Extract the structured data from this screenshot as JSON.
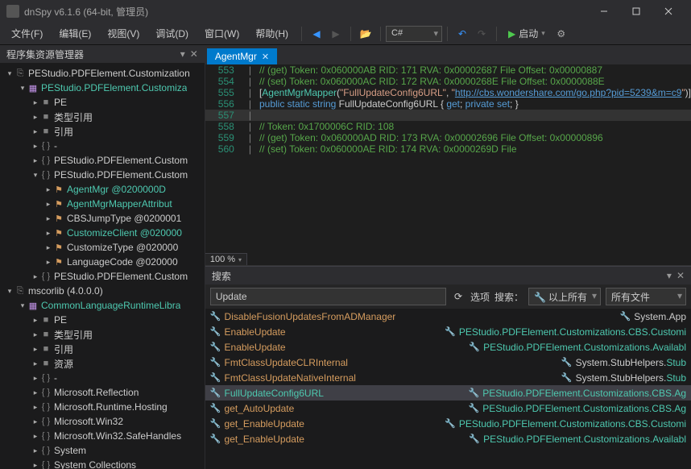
{
  "titlebar": {
    "title": "dnSpy v6.1.6 (64-bit, 管理员)"
  },
  "menu": {
    "file": "文件(F)",
    "edit": "编辑(E)",
    "view": "视图(V)",
    "debug": "调试(D)",
    "window": "窗口(W)",
    "help": "帮助(H)",
    "lang": "C#",
    "run": "启动"
  },
  "sidebar": {
    "title": "程序集资源管理器",
    "tree": [
      {
        "d": 0,
        "exp": "▾",
        "icon": "⎘",
        "iconClass": "gray",
        "label": "PEStudio.PDFElement.Customization",
        "cls": ""
      },
      {
        "d": 1,
        "exp": "▾",
        "icon": "▦",
        "iconClass": "purple",
        "label": "PEStudio.PDFElement.Customiza",
        "cls": "teal"
      },
      {
        "d": 2,
        "exp": "▸",
        "icon": "■",
        "iconClass": "gray",
        "label": "PE",
        "cls": ""
      },
      {
        "d": 2,
        "exp": "▸",
        "icon": "■",
        "iconClass": "gray",
        "label": "类型引用",
        "cls": ""
      },
      {
        "d": 2,
        "exp": "▸",
        "icon": "■",
        "iconClass": "gray",
        "label": "引用",
        "cls": ""
      },
      {
        "d": 2,
        "exp": "▸",
        "icon": "{ }",
        "iconClass": "gray",
        "label": "-",
        "cls": ""
      },
      {
        "d": 2,
        "exp": "▸",
        "icon": "{ }",
        "iconClass": "gray",
        "label": "PEStudio.PDFElement.Custom",
        "cls": ""
      },
      {
        "d": 2,
        "exp": "▾",
        "icon": "{ }",
        "iconClass": "gray",
        "label": "PEStudio.PDFElement.Custom",
        "cls": ""
      },
      {
        "d": 3,
        "exp": "▸",
        "icon": "⚑",
        "iconClass": "orange",
        "label": "AgentMgr @0200000D",
        "cls": "teal",
        "suffixGray": true
      },
      {
        "d": 3,
        "exp": "▸",
        "icon": "⚑",
        "iconClass": "orange",
        "label": "AgentMgrMapperAttribut",
        "cls": "teal"
      },
      {
        "d": 3,
        "exp": "▸",
        "icon": "⚑",
        "iconClass": "orange",
        "label": "CBSJumpType @0200001",
        "cls": ""
      },
      {
        "d": 3,
        "exp": "▸",
        "icon": "⚑",
        "iconClass": "orange",
        "label": "CustomizeClient @020000",
        "cls": "teal"
      },
      {
        "d": 3,
        "exp": "▸",
        "icon": "⚑",
        "iconClass": "orange",
        "label": "CustomizeType @020000",
        "cls": ""
      },
      {
        "d": 3,
        "exp": "▸",
        "icon": "⚑",
        "iconClass": "orange",
        "label": "LanguageCode @020000",
        "cls": ""
      },
      {
        "d": 2,
        "exp": "▸",
        "icon": "{ }",
        "iconClass": "gray",
        "label": "PEStudio.PDFElement.Custom",
        "cls": ""
      },
      {
        "d": 0,
        "exp": "▾",
        "icon": "⎘",
        "iconClass": "gray",
        "label": "mscorlib (4.0.0.0)",
        "cls": ""
      },
      {
        "d": 1,
        "exp": "▾",
        "icon": "▦",
        "iconClass": "purple",
        "label": "CommonLanguageRuntimeLibra",
        "cls": "teal"
      },
      {
        "d": 2,
        "exp": "▸",
        "icon": "■",
        "iconClass": "gray",
        "label": "PE",
        "cls": ""
      },
      {
        "d": 2,
        "exp": "▸",
        "icon": "■",
        "iconClass": "gray",
        "label": "类型引用",
        "cls": ""
      },
      {
        "d": 2,
        "exp": "▸",
        "icon": "■",
        "iconClass": "gray",
        "label": "引用",
        "cls": ""
      },
      {
        "d": 2,
        "exp": "▸",
        "icon": "■",
        "iconClass": "gray",
        "label": "资源",
        "cls": ""
      },
      {
        "d": 2,
        "exp": "▸",
        "icon": "{ }",
        "iconClass": "gray",
        "label": "-",
        "cls": ""
      },
      {
        "d": 2,
        "exp": "▸",
        "icon": "{ }",
        "iconClass": "gray",
        "label": "Microsoft.Reflection",
        "cls": ""
      },
      {
        "d": 2,
        "exp": "▸",
        "icon": "{ }",
        "iconClass": "gray",
        "label": "Microsoft.Runtime.Hosting",
        "cls": ""
      },
      {
        "d": 2,
        "exp": "▸",
        "icon": "{ }",
        "iconClass": "gray",
        "label": "Microsoft.Win32",
        "cls": ""
      },
      {
        "d": 2,
        "exp": "▸",
        "icon": "{ }",
        "iconClass": "gray",
        "label": "Microsoft.Win32.SafeHandles",
        "cls": ""
      },
      {
        "d": 2,
        "exp": "▸",
        "icon": "{ }",
        "iconClass": "gray",
        "label": "System",
        "cls": ""
      },
      {
        "d": 2,
        "exp": "▸",
        "icon": "{ }",
        "iconClass": "gray",
        "label": "System Collections",
        "cls": ""
      }
    ]
  },
  "tab": {
    "label": "AgentMgr"
  },
  "code": {
    "zoom": "100 %",
    "lines": [
      {
        "n": 553,
        "html": "<span class='c-cmt'>// (get) Token: 0x060000AB RID: 171 RVA: 0x00002687 File Offset: 0x00000887</span>"
      },
      {
        "n": 554,
        "html": "<span class='c-cmt'>// (set) Token: 0x060000AC RID: 172 RVA: 0x0000268E File Offset: 0x0000088E</span>"
      },
      {
        "n": 555,
        "html": "[<span class='c-type'>AgentMgrMapper</span>(<span class='c-str'>\"FullUpdateConfig6URL\"</span>, <span class='c-str'>\"</span><span class='c-link'>http://cbs.wondershare.com/go.php?pid=5239&m=c9</span><span class='c-str'>\"</span>)]"
      },
      {
        "n": 556,
        "html": "<span class='c-kw'>public static string</span> FullUpdateConfig6URL { <span class='c-kw'>get</span>; <span class='c-kw'>private set</span>; }"
      },
      {
        "n": 557,
        "html": "",
        "hl": true
      },
      {
        "n": 558,
        "html": "<span class='c-cmt'>// Token: 0x1700006C RID: 108</span>"
      },
      {
        "n": 559,
        "html": "<span class='c-cmt'>// (get) Token: 0x060000AD RID: 173 RVA: 0x00002696 File Offset: 0x00000896</span>"
      },
      {
        "n": 560,
        "html": "<span class='c-cmt'>// (set) Token: 0x060000AE RID: 174 RVA: 0x0000269D File</span>"
      }
    ]
  },
  "search": {
    "title": "搜索",
    "query": "Update",
    "optionLabel": "选项",
    "scopeLabel": "搜索：",
    "scope": "以上所有",
    "fileScope": "所有文件",
    "results": [
      {
        "name": "DisableFusionUpdatesFromADManager",
        "loc": "System.App",
        "locClass": "",
        "sel": false
      },
      {
        "name": "EnableUpdate",
        "loc": "PEStudio.PDFElement.Customizations.CBS.",
        "locClass": "r-loc-t",
        "suffix": "Customi",
        "sel": false
      },
      {
        "name": "EnableUpdate",
        "loc": "PEStudio.PDFElement.Customizations.",
        "locClass": "r-loc-t",
        "suffix": "Availabl",
        "sel": false
      },
      {
        "name": "FmtClassUpdateCLRInternal",
        "loc": "System.StubHelpers.",
        "locClass": "",
        "suffix": "Stub",
        "sel": false
      },
      {
        "name": "FmtClassUpdateNativeInternal",
        "loc": "System.StubHelpers.",
        "locClass": "",
        "suffix": "Stub",
        "sel": false
      },
      {
        "name": "FullUpdateConfig6URL",
        "loc": "PEStudio.PDFElement.Customizations.CBS.",
        "locClass": "r-loc-t",
        "suffix": "Ag",
        "sel": true
      },
      {
        "name": "get_AutoUpdate",
        "loc": "PEStudio.PDFElement.Customizations.CBS.",
        "locClass": "r-loc-t",
        "suffix": "Ag",
        "sel": false
      },
      {
        "name": "get_EnableUpdate",
        "loc": "PEStudio.PDFElement.Customizations.CBS.",
        "locClass": "r-loc-t",
        "suffix": "Customi",
        "sel": false
      },
      {
        "name": "get_EnableUpdate",
        "loc": "PEStudio.PDFElement.Customizations.",
        "locClass": "r-loc-t",
        "suffix": "Availabl",
        "sel": false
      }
    ]
  }
}
